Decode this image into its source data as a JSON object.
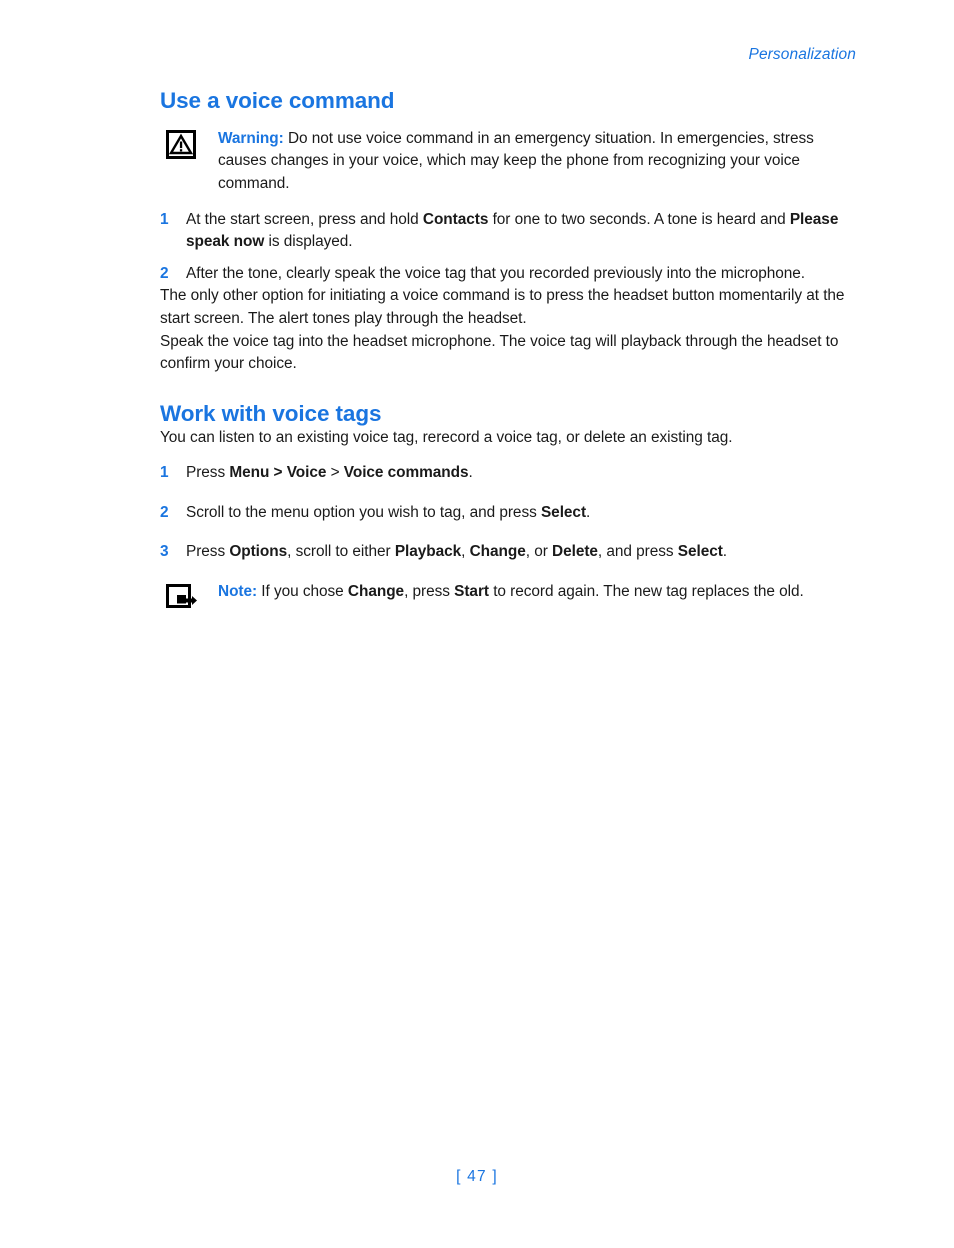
{
  "document": {
    "running_header": "Personalization",
    "page_number": "[ 47 ]",
    "accent_color": "#1a75e0",
    "text_color": "#1a1a1a"
  },
  "sections": [
    {
      "heading": "Use a voice command",
      "warning": {
        "icon": "warning-triangle-icon",
        "label": "Warning:",
        "text": " Do not use voice command in an emergency situation. In emergencies, stress causes changes in your voice, which may keep the phone from recognizing your voice command."
      },
      "steps": [
        {
          "number": "1",
          "parts": [
            {
              "text": "At the start screen, press and hold ",
              "bold": false
            },
            {
              "text": "Contacts",
              "bold": true
            },
            {
              "text": " for one to two seconds. A tone is heard and ",
              "bold": false
            },
            {
              "text": "Please speak now",
              "bold": true
            },
            {
              "text": " is displayed.",
              "bold": false
            }
          ]
        },
        {
          "number": "2",
          "parts": [
            {
              "text": "After the tone, clearly speak the voice tag that you recorded previously into the microphone.",
              "bold": false
            }
          ]
        }
      ],
      "paragraphs": [
        "The only other option for initiating a voice command is to press the headset button momentarily at the start screen. The alert tones play through the headset.",
        "Speak the voice tag into the headset microphone. The voice tag will playback through the headset to confirm your choice."
      ]
    },
    {
      "heading": "Work with voice tags",
      "intro": "You can listen to an existing voice tag, rerecord a voice tag, or delete an existing tag.",
      "steps": [
        {
          "number": "1",
          "parts": [
            {
              "text": "Press ",
              "bold": false
            },
            {
              "text": "Menu > Voice",
              "bold": true
            },
            {
              "text": " > ",
              "bold": false
            },
            {
              "text": "Voice commands",
              "bold": true
            },
            {
              "text": ".",
              "bold": false
            }
          ]
        },
        {
          "number": "2",
          "parts": [
            {
              "text": "Scroll to the menu option you wish to tag, and press ",
              "bold": false
            },
            {
              "text": "Select",
              "bold": true
            },
            {
              "text": ".",
              "bold": false
            }
          ]
        },
        {
          "number": "3",
          "parts": [
            {
              "text": "Press ",
              "bold": false
            },
            {
              "text": "Options",
              "bold": true
            },
            {
              "text": ", scroll to either ",
              "bold": false
            },
            {
              "text": "Playback",
              "bold": true
            },
            {
              "text": ", ",
              "bold": false
            },
            {
              "text": "Change",
              "bold": true
            },
            {
              "text": ", or ",
              "bold": false
            },
            {
              "text": "Delete",
              "bold": true
            },
            {
              "text": ", and press ",
              "bold": false
            },
            {
              "text": "Select",
              "bold": true
            },
            {
              "text": ".",
              "bold": false
            }
          ]
        }
      ],
      "note": {
        "icon": "note-hand-pointer-icon",
        "label": "Note:",
        "parts": [
          {
            "text": " If you chose ",
            "bold": false
          },
          {
            "text": "Change",
            "bold": true
          },
          {
            "text": ", press ",
            "bold": false
          },
          {
            "text": "Start",
            "bold": true
          },
          {
            "text": " to record again. The new tag replaces the old.",
            "bold": false
          }
        ]
      }
    }
  ]
}
